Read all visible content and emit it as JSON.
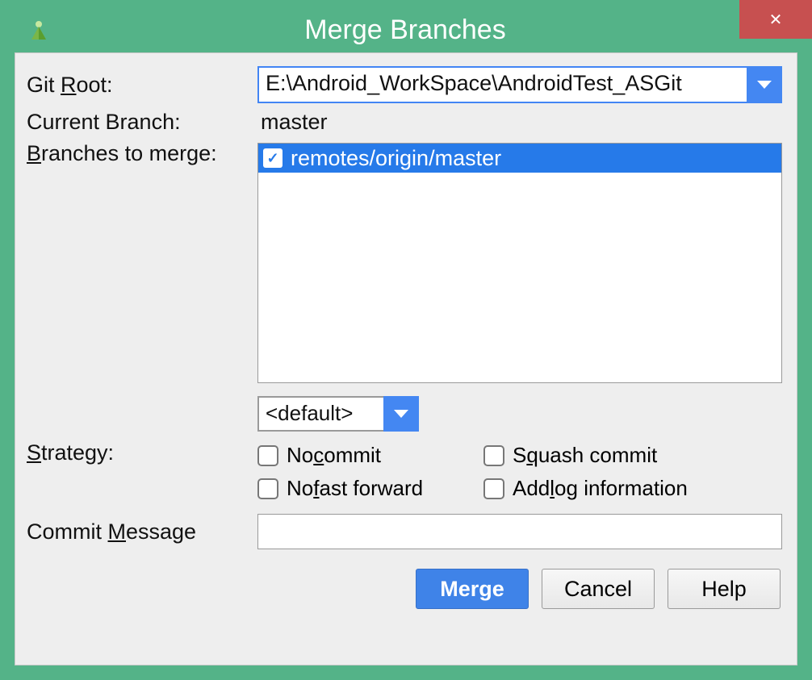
{
  "title": "Merge Branches",
  "closeGlyph": "✕",
  "labels": {
    "gitRootPre": "Git ",
    "gitRootU": "R",
    "gitRootPost": "oot:",
    "currentBranch": "Current Branch:",
    "branchesU": "B",
    "branchesPost": "ranches to merge:",
    "strategyU": "S",
    "strategyPost": "trategy:",
    "commitMsgPre": "Commit ",
    "commitMsgU": "M",
    "commitMsgPost": "essage"
  },
  "gitRoot": {
    "value": "E:\\Android_WorkSpace\\AndroidTest_ASGit"
  },
  "currentBranch": "master",
  "branchList": {
    "items": [
      {
        "checked": true,
        "label": "remotes/origin/master"
      }
    ]
  },
  "strategy": {
    "value": "<default>"
  },
  "checks": {
    "noCommitPre": "No ",
    "noCommitU": "c",
    "noCommitPost": "ommit",
    "squashPre": "S",
    "squashU": "q",
    "squashPost": "uash commit",
    "noFFPre": "No ",
    "noFFU": "f",
    "noFFPost": "ast forward",
    "addLogPre": "Add ",
    "addLogU": "l",
    "addLogPost": "og information"
  },
  "commitMessage": "",
  "buttons": {
    "merge": "Merge",
    "cancel": "Cancel",
    "help": "Help"
  }
}
